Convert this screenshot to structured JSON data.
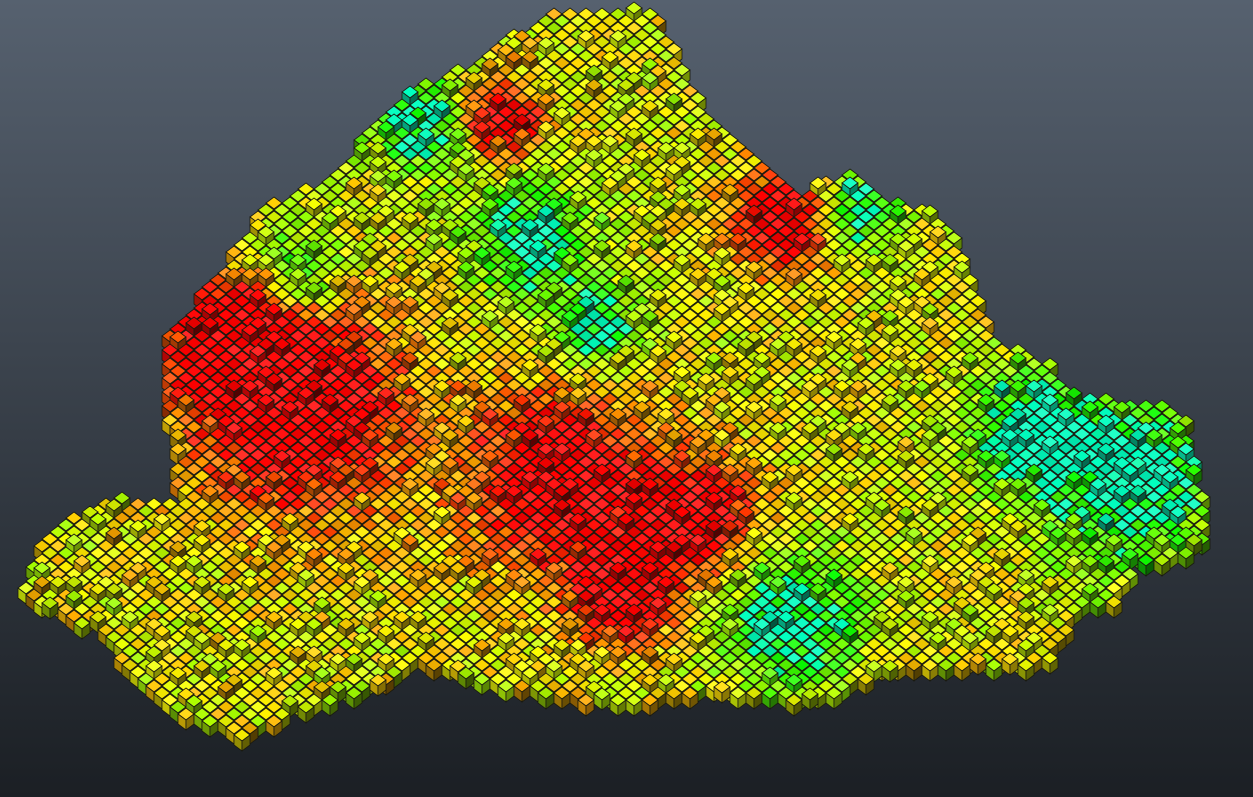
{
  "viewport": {
    "background_top": "#56616f",
    "background_bottom": "#1b1f24",
    "edge_color": "#1a1a10"
  },
  "block_model": {
    "color_scale": [
      "#ff1a00",
      "#ff7a00",
      "#ffd800",
      "#c8ff00",
      "#2cff00",
      "#00e8a0"
    ]
  }
}
